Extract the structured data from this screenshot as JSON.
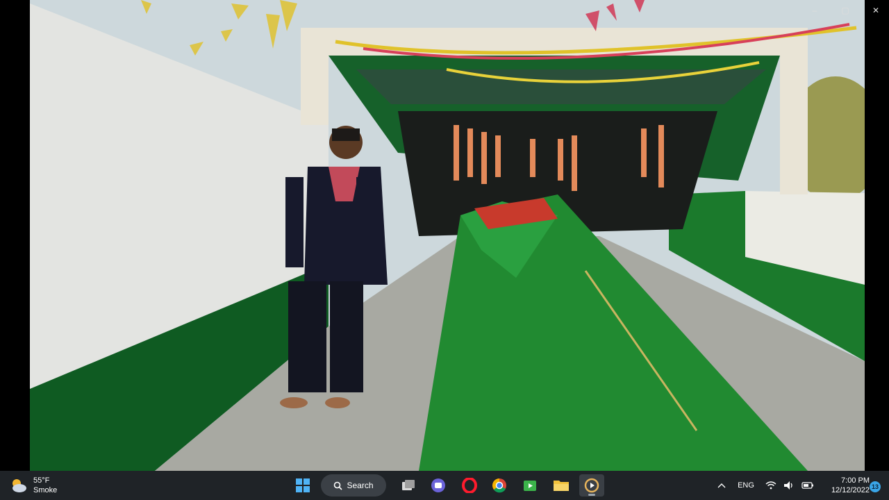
{
  "window": {
    "controls": {
      "minimize": "–",
      "maximize": "▢",
      "close": "✕"
    },
    "photo_description_colors": {
      "sky": "#cdd8dc",
      "wall": "#e4e4e2",
      "green": "#1c7a2c"
    }
  },
  "taskbar": {
    "weather": {
      "temp": "55°F",
      "condition": "Smoke",
      "icon": "cloudy-weather-icon"
    },
    "search_label": "Search",
    "apps": [
      {
        "name": "start-button",
        "icon": "windows-logo-icon"
      },
      {
        "name": "task-view-button",
        "icon": "task-view-icon"
      },
      {
        "name": "teams-chat-button",
        "icon": "chat-icon"
      },
      {
        "name": "opera-browser-button",
        "icon": "opera-icon"
      },
      {
        "name": "chrome-button",
        "icon": "chrome-icon"
      },
      {
        "name": "media-editor-button",
        "icon": "video-editor-icon"
      },
      {
        "name": "file-explorer-button",
        "icon": "folder-icon"
      },
      {
        "name": "media-player-button",
        "icon": "media-player-icon"
      }
    ],
    "tray": {
      "language": "ENG",
      "time": "7:00 PM",
      "date": "12/12/2022",
      "notification_count": "13"
    },
    "colors": {
      "accent": "#3aa6e8",
      "background": "#1f2327"
    }
  }
}
